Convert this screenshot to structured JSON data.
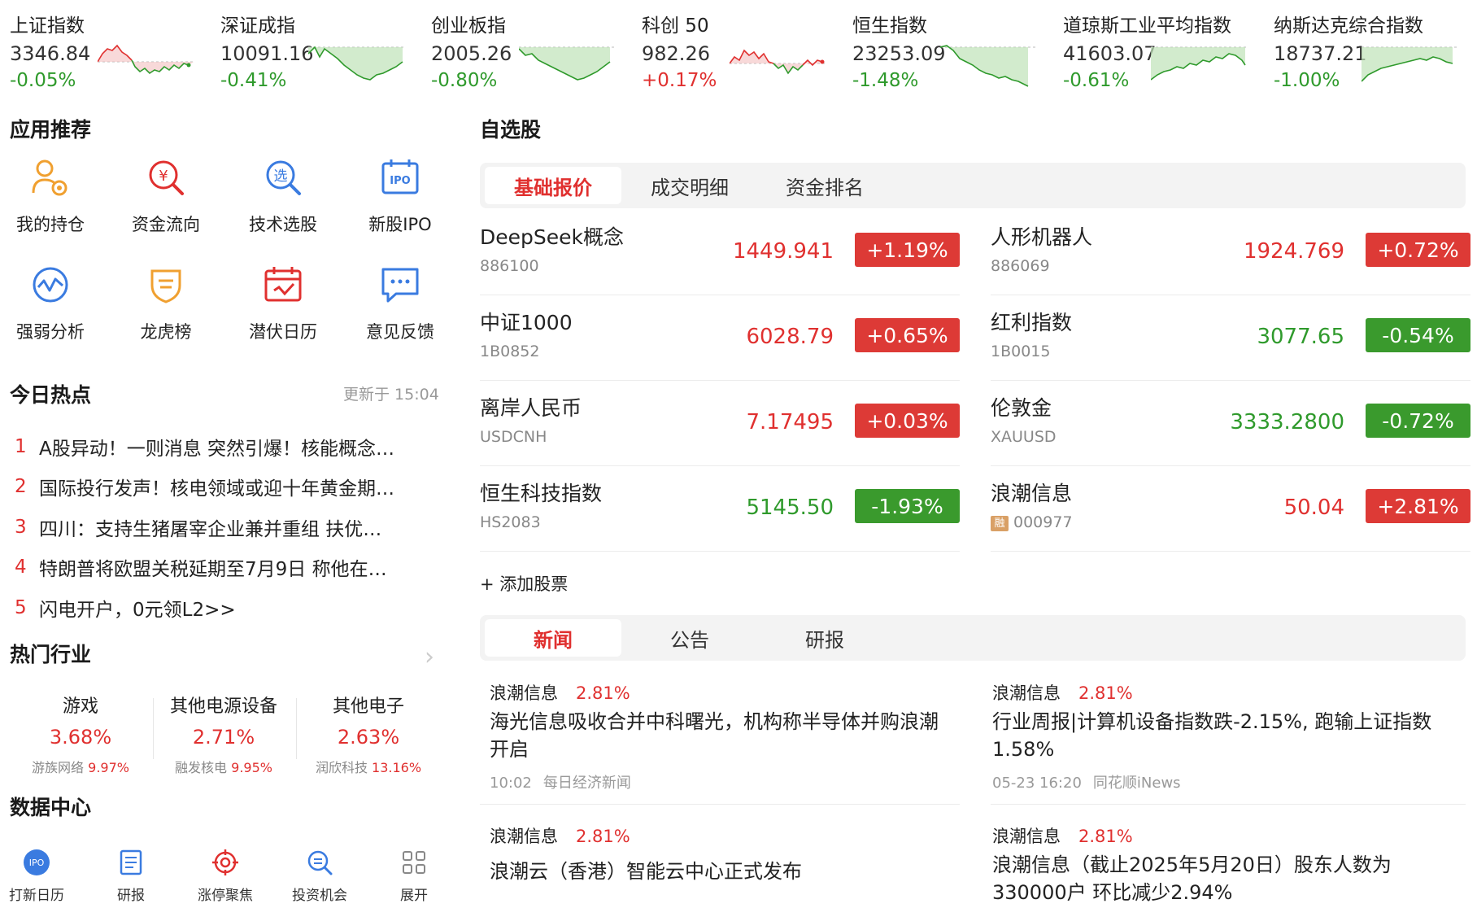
{
  "indices": [
    {
      "name": "上证指数",
      "value": "3346.84",
      "change": "-0.05%",
      "trend": "down"
    },
    {
      "name": "深证成指",
      "value": "10091.16",
      "change": "-0.41%",
      "trend": "down"
    },
    {
      "name": "创业板指",
      "value": "2005.26",
      "change": "-0.80%",
      "trend": "down"
    },
    {
      "name": "科创 50",
      "value": "982.26",
      "change": "+0.17%",
      "trend": "up"
    },
    {
      "name": "恒生指数",
      "value": "23253.09",
      "change": "-1.48%",
      "trend": "down"
    },
    {
      "name": "道琼斯工业平均指数",
      "value": "41603.07",
      "change": "-0.61%",
      "trend": "down"
    },
    {
      "name": "纳斯达克综合指数",
      "value": "18737.21",
      "change": "-1.00%",
      "trend": "down"
    }
  ],
  "apps": {
    "title": "应用推荐",
    "items": [
      {
        "label": "我的持仓",
        "icon": "user-holdings-icon"
      },
      {
        "label": "资金流向",
        "icon": "yuan-search-icon"
      },
      {
        "label": "技术选股",
        "icon": "stock-picker-icon"
      },
      {
        "label": "新股IPO",
        "icon": "ipo-calendar-icon"
      },
      {
        "label": "强弱分析",
        "icon": "wave-analysis-icon"
      },
      {
        "label": "龙虎榜",
        "icon": "badge-shield-icon"
      },
      {
        "label": "潜伏日历",
        "icon": "calendar-check-icon"
      },
      {
        "label": "意见反馈",
        "icon": "chat-bubble-icon"
      }
    ]
  },
  "hot": {
    "title": "今日热点",
    "updated": "更新于 15:04",
    "items": [
      {
        "rank": "1",
        "text": "A股异动！一则消息 突然引爆！核能概念…"
      },
      {
        "rank": "2",
        "text": "国际投行发声！核电领域或迎十年黄金期…"
      },
      {
        "rank": "3",
        "text": "四川：支持生猪屠宰企业兼并重组 扶优…"
      },
      {
        "rank": "4",
        "text": "特朗普将欧盟关税延期至7月9日 称他在…"
      },
      {
        "rank": "5",
        "text": "闪电开户，0元领L2>>"
      }
    ]
  },
  "industry": {
    "title": "热门行业",
    "items": [
      {
        "name": "游戏",
        "pct": "3.68%",
        "leader": "游族网络",
        "leader_pct": "9.97%"
      },
      {
        "name": "其他电源设备",
        "pct": "2.71%",
        "leader": "融发核电",
        "leader_pct": "9.95%"
      },
      {
        "name": "其他电子",
        "pct": "2.63%",
        "leader": "润欣科技",
        "leader_pct": "13.16%"
      }
    ]
  },
  "datacenter": {
    "title": "数据中心",
    "items": [
      {
        "label": "打新日历",
        "icon": "ipo-circle-icon"
      },
      {
        "label": "研报",
        "icon": "report-icon"
      },
      {
        "label": "涨停聚焦",
        "icon": "target-icon"
      },
      {
        "label": "投资机会",
        "icon": "search-coin-icon"
      },
      {
        "label": "展开",
        "icon": "grid-expand-icon"
      }
    ]
  },
  "watchlist": {
    "title": "自选股",
    "tabs": [
      "基础报价",
      "成交明细",
      "资金排名"
    ],
    "active_tab": 0,
    "stocks": [
      {
        "name": "DeepSeek概念",
        "code": "886100",
        "price": "1449.941",
        "change": "+1.19%",
        "dir": "up"
      },
      {
        "name": "人形机器人",
        "code": "886069",
        "price": "1924.769",
        "change": "+0.72%",
        "dir": "up"
      },
      {
        "name": "中证1000",
        "code": "1B0852",
        "price": "6028.79",
        "change": "+0.65%",
        "dir": "up"
      },
      {
        "name": "红利指数",
        "code": "1B0015",
        "price": "3077.65",
        "change": "-0.54%",
        "dir": "down"
      },
      {
        "name": "离岸人民币",
        "code": "USDCNH",
        "price": "7.17495",
        "change": "+0.03%",
        "dir": "up"
      },
      {
        "name": "伦敦金",
        "code": "XAUUSD",
        "price": "3333.2800",
        "change": "-0.72%",
        "dir": "down"
      },
      {
        "name": "恒生科技指数",
        "code": "HS2083",
        "price": "5145.50",
        "change": "-1.93%",
        "dir": "down"
      },
      {
        "name": "浪潮信息",
        "code": "000977",
        "price": "50.04",
        "change": "+2.81%",
        "dir": "up",
        "badge": "融"
      }
    ],
    "add_label": "+ 添加股票"
  },
  "news": {
    "tabs": [
      "新闻",
      "公告",
      "研报"
    ],
    "active_tab": 0,
    "items": [
      {
        "stock": "浪潮信息",
        "pct": "2.81%",
        "title": "海光信息吸收合并中科曙光，机构称半导体并购浪潮开启",
        "time": "10:02",
        "source": "每日经济新闻"
      },
      {
        "stock": "浪潮信息",
        "pct": "2.81%",
        "title": "行业周报|计算机设备指数跌-2.15%, 跑输上证指数1.58%",
        "time": "05-23 16:20",
        "source": "同花顺iNews"
      },
      {
        "stock": "浪潮信息",
        "pct": "2.81%",
        "title": "浪潮云（香港）智能云中心正式发布",
        "time": "",
        "source": ""
      },
      {
        "stock": "浪潮信息",
        "pct": "2.81%",
        "title": "浪潮信息（截止2025年5月20日）股东人数为330000户 环比减少2.94%",
        "time": "",
        "source": ""
      }
    ]
  },
  "colors": {
    "up": "#e0302f",
    "down": "#2f9a2c"
  }
}
